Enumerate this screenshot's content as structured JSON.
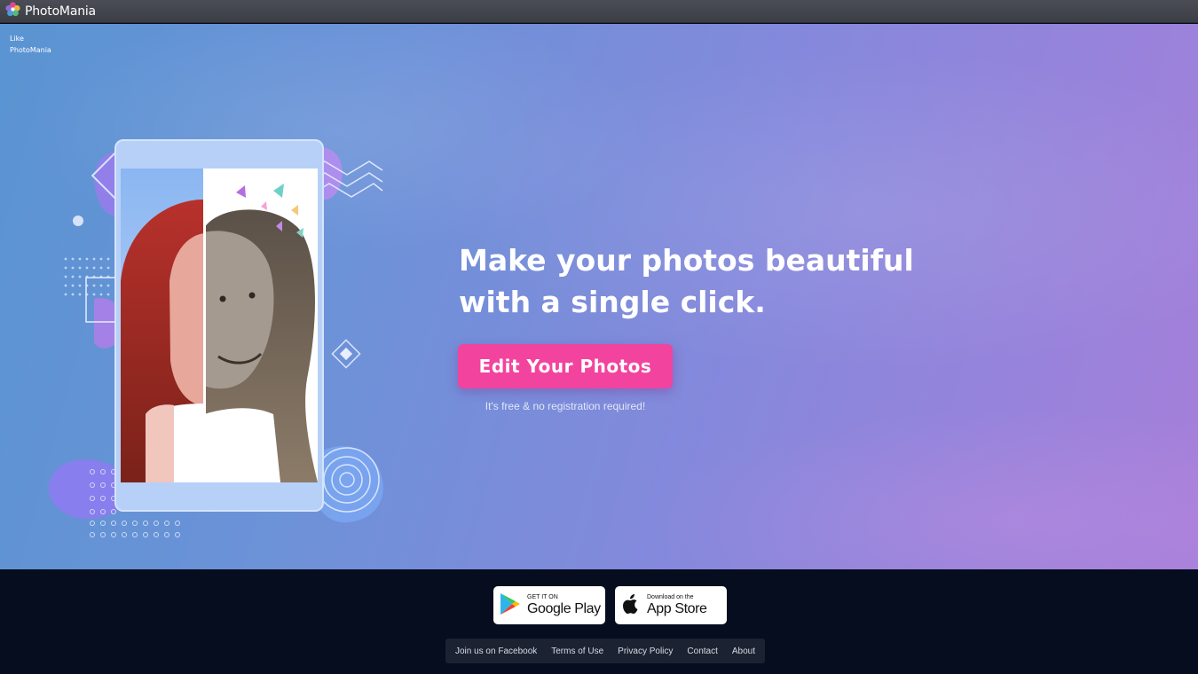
{
  "header": {
    "brand": "PhotoMania",
    "logo_icon": "pinwheel-icon"
  },
  "hero": {
    "like_line1": "Like",
    "like_line2": "PhotoMania",
    "headline_line1": "Make your photos beautiful",
    "headline_line2": "with a single click.",
    "cta_label": "Edit Your Photos",
    "note": "It's free & no registration required!"
  },
  "store_badges": {
    "google": {
      "small": "GET IT ON",
      "big": "Google Play",
      "icon": "google-play-icon"
    },
    "apple": {
      "small": "Download on the",
      "big": "App Store",
      "icon": "apple-icon"
    }
  },
  "footer_links": [
    "Join us on Facebook",
    "Terms of Use",
    "Privacy Policy",
    "Contact",
    "About"
  ],
  "colors": {
    "accent": "#f2449e",
    "footer_bg": "#050d1e",
    "topbar_bg": "#43464d"
  }
}
